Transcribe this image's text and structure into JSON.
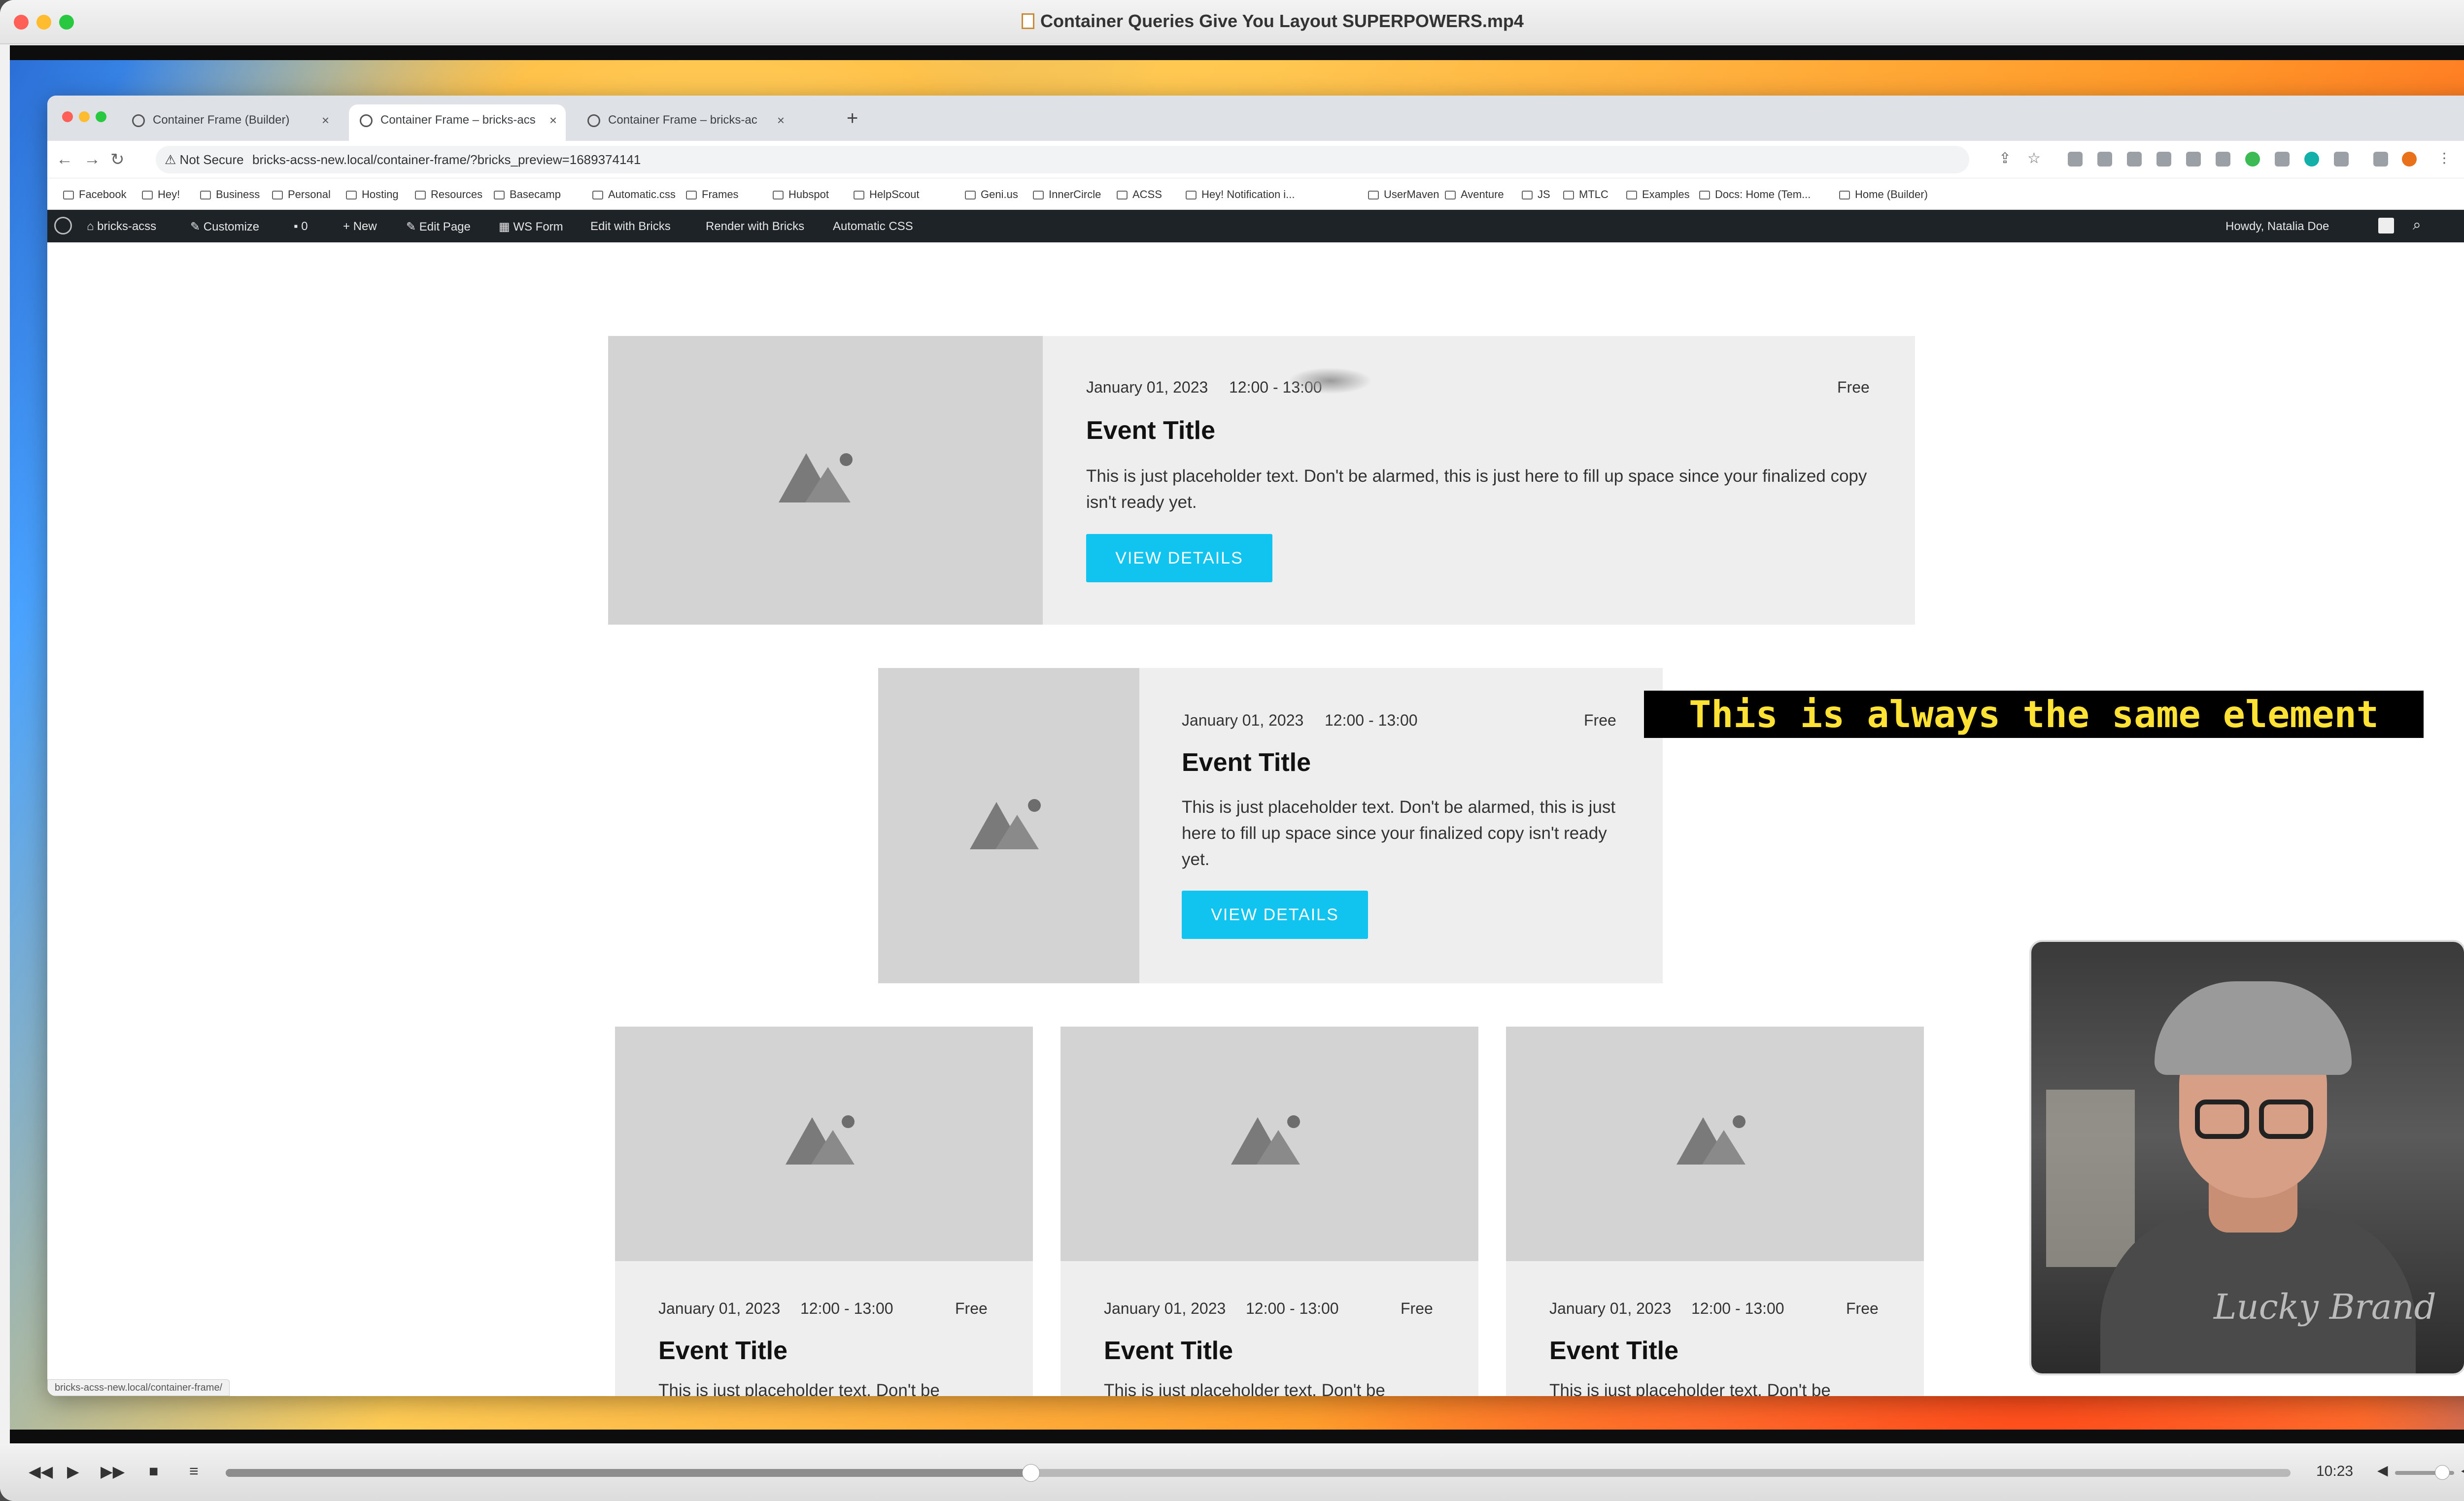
{
  "window": {
    "title": "Container Queries Give You Layout SUPERPOWERS.mp4",
    "traffic_colors": [
      "#ff5f57",
      "#febc2e",
      "#28c840"
    ]
  },
  "browser": {
    "tabs": [
      {
        "label": "Container Frame (Builder)",
        "active": false
      },
      {
        "label": "Container Frame – bricks-acs",
        "active": true
      },
      {
        "label": "Container Frame – bricks-ac",
        "active": false
      }
    ],
    "not_secure": "Not Secure",
    "url": "bricks-acss-new.local/container-frame/?bricks_preview=1689374141",
    "bookmarks": [
      "Facebook",
      "Hey!",
      "Business",
      "Personal",
      "Hosting",
      "Resources",
      "Basecamp",
      "Automatic.css",
      "Frames",
      "Hubspot",
      "HelpScout",
      "Geni.us",
      "InnerCircle",
      "ACSS",
      "Hey! Notification i...",
      "UserMaven",
      "Aventure",
      "JS",
      "MTLC",
      "Examples",
      "Docs: Home (Tem...",
      "Home (Builder)"
    ],
    "status_url": "bricks-acss-new.local/container-frame/"
  },
  "wp_admin_bar": {
    "site": "bricks-acss",
    "customize": "Customize",
    "comments": "0",
    "new": "New",
    "edit_page": "Edit Page",
    "ws_form": "WS Form",
    "edit_bricks": "Edit with Bricks",
    "render_bricks": "Render with Bricks",
    "acss": "Automatic CSS",
    "howdy": "Howdy, Natalia Doe"
  },
  "event": {
    "date": "January 01, 2023",
    "time": "12:00 - 13:00",
    "price": "Free",
    "title": "Event Title",
    "body": "This is just placeholder text. Don't be alarmed, this is just here to fill up space since your finalized copy isn't ready yet.",
    "body_cut": "This is just placeholder text. Don't be",
    "cta": "VIEW DETAILS",
    "accent": "#10c4ef"
  },
  "caption": "This is always the same element",
  "player": {
    "time": "10:23",
    "progress": 0.39,
    "volume": 0.8
  }
}
